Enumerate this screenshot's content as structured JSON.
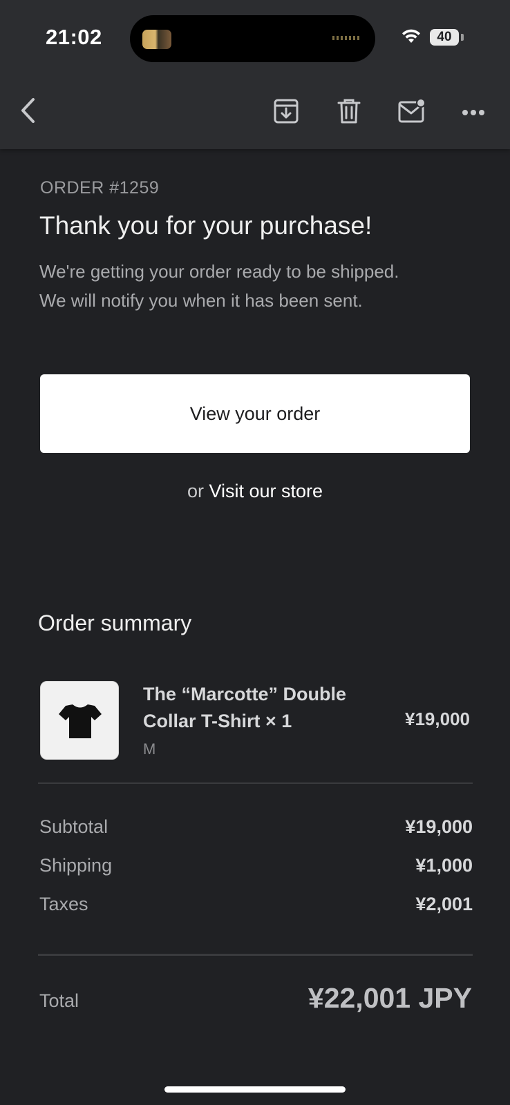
{
  "status_bar": {
    "time": "21:02",
    "battery": "40"
  },
  "toolbar": {
    "back_icon": "chevron-left-icon",
    "archive_icon": "archive-icon",
    "delete_icon": "trash-icon",
    "mark_unread_icon": "mail-unread-icon",
    "more_icon": "more-horizontal-icon"
  },
  "email": {
    "order_number": "ORDER #1259",
    "headline": "Thank you for your purchase!",
    "subtext_line1": "We're getting your order ready to be shipped.",
    "subtext_line2": "We will notify you when it has been sent.",
    "view_order_label": "View your order",
    "or_text": "or",
    "visit_store_label": "Visit our store"
  },
  "order_summary": {
    "title": "Order summary",
    "items": [
      {
        "name_line1": "The “Marcotte” Double",
        "name_line2": "Collar T-Shirt × 1",
        "variant": "M",
        "price": "¥19,000",
        "image_icon": "tshirt-icon"
      }
    ],
    "subtotal_label": "Subtotal",
    "subtotal_value": "¥19,000",
    "shipping_label": "Shipping",
    "shipping_value": "¥1,000",
    "taxes_label": "Taxes",
    "taxes_value": "¥2,001",
    "total_label": "Total",
    "total_value": "¥22,001 JPY"
  },
  "colors": {
    "background": "#202124",
    "toolbar": "#2c2d30",
    "button": "#ffffff"
  }
}
